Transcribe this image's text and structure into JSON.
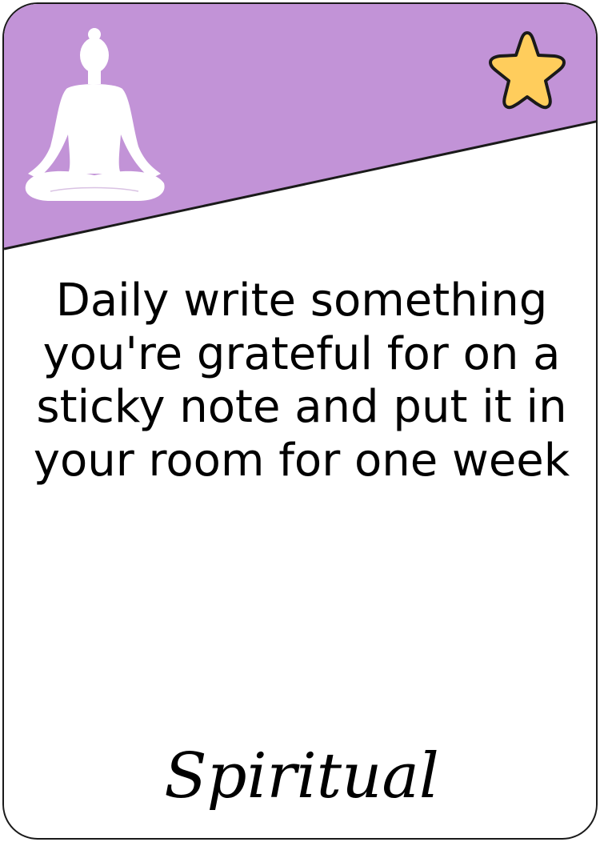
{
  "card": {
    "message": "Daily write something you're grateful for on a sticky note and put it in your room for one week",
    "category": "Spiritual"
  },
  "colors": {
    "band": "#c293d7",
    "star_fill": "#ffcd5c",
    "outline": "#1a1a1a",
    "figure": "#ffffff"
  },
  "icons": {
    "figure": "meditating-person-icon",
    "badge": "star-icon"
  }
}
